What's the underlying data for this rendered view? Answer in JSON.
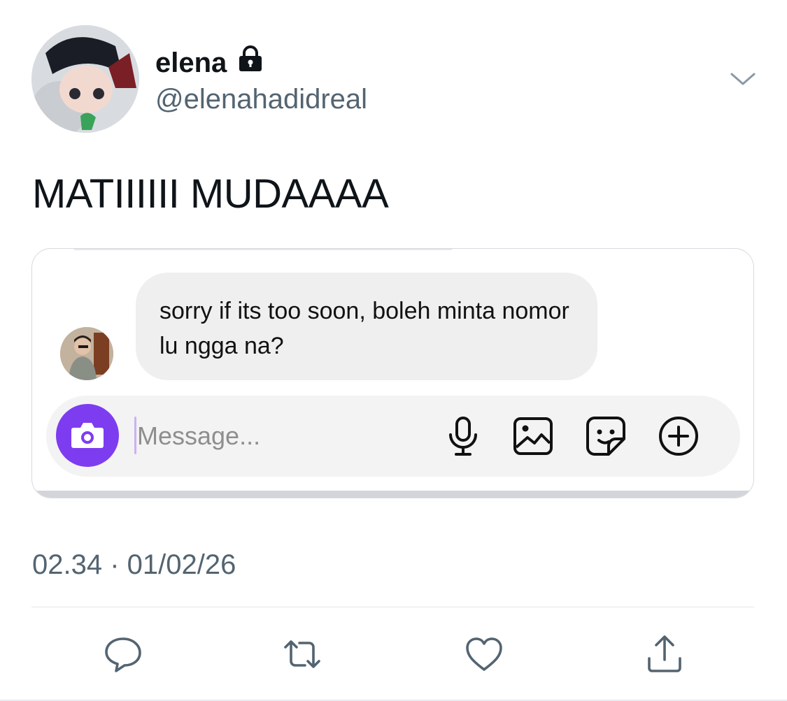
{
  "tweet": {
    "display_name": "elena",
    "handle": "@elenahadidreal",
    "text": "MATIIIIII MUDAAAA",
    "timestamp": "02.34 · 01/02/26"
  },
  "dm_screenshot": {
    "message": "sorry if its too soon, boleh minta nomor lu ngga na?",
    "composer_placeholder": "Message...",
    "accent_color": "#7e3cf0"
  },
  "icons": {
    "lock": "lock-icon",
    "chevron": "chevron-down-icon",
    "camera": "camera-icon",
    "mic": "microphone-icon",
    "gallery": "image-icon",
    "sticker": "sticker-icon",
    "plus": "plus-circle-icon",
    "reply": "reply-icon",
    "retweet": "retweet-icon",
    "like": "heart-icon",
    "share": "share-icon"
  },
  "colors": {
    "text_primary": "#0f1419",
    "text_secondary": "#536471",
    "divider": "#e1e6ea"
  }
}
